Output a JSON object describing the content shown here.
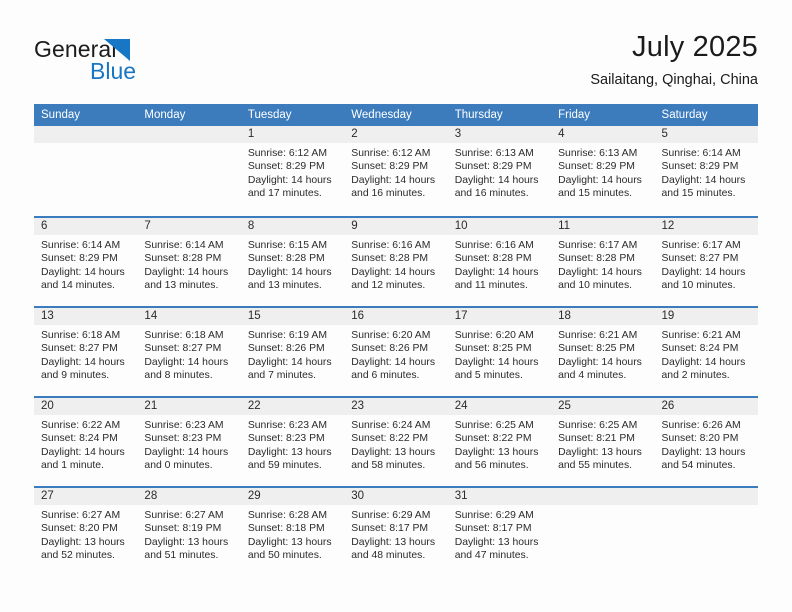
{
  "brand": {
    "name_part1": "General",
    "name_part2": "Blue",
    "triangle_icon": "brand-triangle-icon",
    "accent_color": "#1877c4"
  },
  "header": {
    "title": "July 2025",
    "subtitle": "Sailaitang, Qinghai, China"
  },
  "theme": {
    "header_blue": "#3c7cbd",
    "daynum_band": "#efefef",
    "text": "#2b2b2b",
    "page_bg": "#fdfdfd"
  },
  "calendar": {
    "weekday_headers": [
      "Sunday",
      "Monday",
      "Tuesday",
      "Wednesday",
      "Thursday",
      "Friday",
      "Saturday"
    ],
    "weeks": [
      [
        {
          "day": "",
          "sunrise": "",
          "sunset": "",
          "daylight_1": "",
          "daylight_2": ""
        },
        {
          "day": "",
          "sunrise": "",
          "sunset": "",
          "daylight_1": "",
          "daylight_2": ""
        },
        {
          "day": "1",
          "sunrise": "Sunrise: 6:12 AM",
          "sunset": "Sunset: 8:29 PM",
          "daylight_1": "Daylight: 14 hours",
          "daylight_2": "and 17 minutes."
        },
        {
          "day": "2",
          "sunrise": "Sunrise: 6:12 AM",
          "sunset": "Sunset: 8:29 PM",
          "daylight_1": "Daylight: 14 hours",
          "daylight_2": "and 16 minutes."
        },
        {
          "day": "3",
          "sunrise": "Sunrise: 6:13 AM",
          "sunset": "Sunset: 8:29 PM",
          "daylight_1": "Daylight: 14 hours",
          "daylight_2": "and 16 minutes."
        },
        {
          "day": "4",
          "sunrise": "Sunrise: 6:13 AM",
          "sunset": "Sunset: 8:29 PM",
          "daylight_1": "Daylight: 14 hours",
          "daylight_2": "and 15 minutes."
        },
        {
          "day": "5",
          "sunrise": "Sunrise: 6:14 AM",
          "sunset": "Sunset: 8:29 PM",
          "daylight_1": "Daylight: 14 hours",
          "daylight_2": "and 15 minutes."
        }
      ],
      [
        {
          "day": "6",
          "sunrise": "Sunrise: 6:14 AM",
          "sunset": "Sunset: 8:29 PM",
          "daylight_1": "Daylight: 14 hours",
          "daylight_2": "and 14 minutes."
        },
        {
          "day": "7",
          "sunrise": "Sunrise: 6:14 AM",
          "sunset": "Sunset: 8:28 PM",
          "daylight_1": "Daylight: 14 hours",
          "daylight_2": "and 13 minutes."
        },
        {
          "day": "8",
          "sunrise": "Sunrise: 6:15 AM",
          "sunset": "Sunset: 8:28 PM",
          "daylight_1": "Daylight: 14 hours",
          "daylight_2": "and 13 minutes."
        },
        {
          "day": "9",
          "sunrise": "Sunrise: 6:16 AM",
          "sunset": "Sunset: 8:28 PM",
          "daylight_1": "Daylight: 14 hours",
          "daylight_2": "and 12 minutes."
        },
        {
          "day": "10",
          "sunrise": "Sunrise: 6:16 AM",
          "sunset": "Sunset: 8:28 PM",
          "daylight_1": "Daylight: 14 hours",
          "daylight_2": "and 11 minutes."
        },
        {
          "day": "11",
          "sunrise": "Sunrise: 6:17 AM",
          "sunset": "Sunset: 8:28 PM",
          "daylight_1": "Daylight: 14 hours",
          "daylight_2": "and 10 minutes."
        },
        {
          "day": "12",
          "sunrise": "Sunrise: 6:17 AM",
          "sunset": "Sunset: 8:27 PM",
          "daylight_1": "Daylight: 14 hours",
          "daylight_2": "and 10 minutes."
        }
      ],
      [
        {
          "day": "13",
          "sunrise": "Sunrise: 6:18 AM",
          "sunset": "Sunset: 8:27 PM",
          "daylight_1": "Daylight: 14 hours",
          "daylight_2": "and 9 minutes."
        },
        {
          "day": "14",
          "sunrise": "Sunrise: 6:18 AM",
          "sunset": "Sunset: 8:27 PM",
          "daylight_1": "Daylight: 14 hours",
          "daylight_2": "and 8 minutes."
        },
        {
          "day": "15",
          "sunrise": "Sunrise: 6:19 AM",
          "sunset": "Sunset: 8:26 PM",
          "daylight_1": "Daylight: 14 hours",
          "daylight_2": "and 7 minutes."
        },
        {
          "day": "16",
          "sunrise": "Sunrise: 6:20 AM",
          "sunset": "Sunset: 8:26 PM",
          "daylight_1": "Daylight: 14 hours",
          "daylight_2": "and 6 minutes."
        },
        {
          "day": "17",
          "sunrise": "Sunrise: 6:20 AM",
          "sunset": "Sunset: 8:25 PM",
          "daylight_1": "Daylight: 14 hours",
          "daylight_2": "and 5 minutes."
        },
        {
          "day": "18",
          "sunrise": "Sunrise: 6:21 AM",
          "sunset": "Sunset: 8:25 PM",
          "daylight_1": "Daylight: 14 hours",
          "daylight_2": "and 4 minutes."
        },
        {
          "day": "19",
          "sunrise": "Sunrise: 6:21 AM",
          "sunset": "Sunset: 8:24 PM",
          "daylight_1": "Daylight: 14 hours",
          "daylight_2": "and 2 minutes."
        }
      ],
      [
        {
          "day": "20",
          "sunrise": "Sunrise: 6:22 AM",
          "sunset": "Sunset: 8:24 PM",
          "daylight_1": "Daylight: 14 hours",
          "daylight_2": "and 1 minute."
        },
        {
          "day": "21",
          "sunrise": "Sunrise: 6:23 AM",
          "sunset": "Sunset: 8:23 PM",
          "daylight_1": "Daylight: 14 hours",
          "daylight_2": "and 0 minutes."
        },
        {
          "day": "22",
          "sunrise": "Sunrise: 6:23 AM",
          "sunset": "Sunset: 8:23 PM",
          "daylight_1": "Daylight: 13 hours",
          "daylight_2": "and 59 minutes."
        },
        {
          "day": "23",
          "sunrise": "Sunrise: 6:24 AM",
          "sunset": "Sunset: 8:22 PM",
          "daylight_1": "Daylight: 13 hours",
          "daylight_2": "and 58 minutes."
        },
        {
          "day": "24",
          "sunrise": "Sunrise: 6:25 AM",
          "sunset": "Sunset: 8:22 PM",
          "daylight_1": "Daylight: 13 hours",
          "daylight_2": "and 56 minutes."
        },
        {
          "day": "25",
          "sunrise": "Sunrise: 6:25 AM",
          "sunset": "Sunset: 8:21 PM",
          "daylight_1": "Daylight: 13 hours",
          "daylight_2": "and 55 minutes."
        },
        {
          "day": "26",
          "sunrise": "Sunrise: 6:26 AM",
          "sunset": "Sunset: 8:20 PM",
          "daylight_1": "Daylight: 13 hours",
          "daylight_2": "and 54 minutes."
        }
      ],
      [
        {
          "day": "27",
          "sunrise": "Sunrise: 6:27 AM",
          "sunset": "Sunset: 8:20 PM",
          "daylight_1": "Daylight: 13 hours",
          "daylight_2": "and 52 minutes."
        },
        {
          "day": "28",
          "sunrise": "Sunrise: 6:27 AM",
          "sunset": "Sunset: 8:19 PM",
          "daylight_1": "Daylight: 13 hours",
          "daylight_2": "and 51 minutes."
        },
        {
          "day": "29",
          "sunrise": "Sunrise: 6:28 AM",
          "sunset": "Sunset: 8:18 PM",
          "daylight_1": "Daylight: 13 hours",
          "daylight_2": "and 50 minutes."
        },
        {
          "day": "30",
          "sunrise": "Sunrise: 6:29 AM",
          "sunset": "Sunset: 8:17 PM",
          "daylight_1": "Daylight: 13 hours",
          "daylight_2": "and 48 minutes."
        },
        {
          "day": "31",
          "sunrise": "Sunrise: 6:29 AM",
          "sunset": "Sunset: 8:17 PM",
          "daylight_1": "Daylight: 13 hours",
          "daylight_2": "and 47 minutes."
        },
        {
          "day": "",
          "sunrise": "",
          "sunset": "",
          "daylight_1": "",
          "daylight_2": ""
        },
        {
          "day": "",
          "sunrise": "",
          "sunset": "",
          "daylight_1": "",
          "daylight_2": ""
        }
      ]
    ]
  }
}
